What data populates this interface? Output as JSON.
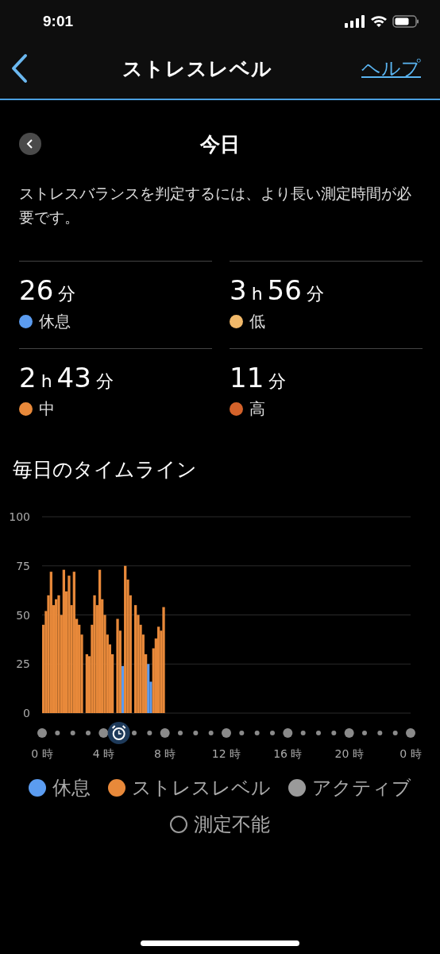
{
  "status_bar": {
    "time": "9:01"
  },
  "nav": {
    "title": "ストレスレベル",
    "help": "ヘルプ"
  },
  "day": {
    "title": "今日"
  },
  "message": "ストレスバランスを判定するには、より長い測定時間が必要です。",
  "stats": [
    {
      "parts": [
        {
          "value": "26",
          "unit": "分"
        }
      ],
      "label": "休息",
      "color": "#5b9cf0"
    },
    {
      "parts": [
        {
          "value": "3",
          "unit": "h"
        },
        {
          "value": "56",
          "unit": "分"
        }
      ],
      "label": "低",
      "color": "#f2b96a"
    },
    {
      "parts": [
        {
          "value": "2",
          "unit": "h"
        },
        {
          "value": "43",
          "unit": "分"
        }
      ],
      "label": "中",
      "color": "#e8893a"
    },
    {
      "parts": [
        {
          "value": "11",
          "unit": "分"
        }
      ],
      "label": "高",
      "color": "#d4622a"
    }
  ],
  "timeline": {
    "title": "毎日のタイムライン",
    "end_label": "0 時",
    "chart_data": {
      "type": "bar",
      "grid": true,
      "legend": "bottom",
      "x": [
        0,
        0.17,
        0.33,
        0.5,
        0.67,
        0.83,
        1,
        1.17,
        1.33,
        1.5,
        1.67,
        1.83,
        2,
        2.17,
        2.33,
        2.5,
        2.67,
        2.83,
        3,
        3.17,
        3.33,
        3.5,
        3.67,
        3.83,
        4,
        4.17,
        4.33,
        4.5,
        4.67,
        4.83,
        5,
        5.17,
        5.33,
        5.5,
        5.67,
        5.83,
        6,
        6.17,
        6.33,
        6.5,
        6.67,
        6.83,
        7,
        7.17,
        7.33,
        7.5,
        7.67,
        7.83
      ],
      "series": [
        {
          "name": "休息",
          "color": "#5b9cf0",
          "values": [
            null,
            null,
            null,
            null,
            null,
            null,
            null,
            null,
            null,
            null,
            null,
            null,
            null,
            null,
            null,
            null,
            null,
            null,
            null,
            null,
            null,
            null,
            null,
            null,
            null,
            null,
            null,
            null,
            null,
            null,
            null,
            24,
            null,
            null,
            null,
            null,
            null,
            null,
            null,
            null,
            null,
            25,
            16,
            null,
            null,
            null,
            null,
            null
          ]
        },
        {
          "name": "ストレスレベル",
          "color": "#e8893a",
          "values": [
            45,
            52,
            60,
            72,
            55,
            58,
            60,
            50,
            73,
            62,
            70,
            55,
            72,
            48,
            45,
            40,
            0,
            30,
            29,
            45,
            60,
            55,
            73,
            58,
            50,
            40,
            35,
            30,
            0,
            48,
            42,
            null,
            75,
            68,
            60,
            0,
            55,
            50,
            45,
            40,
            30,
            null,
            null,
            33,
            38,
            44,
            42,
            54
          ]
        }
      ],
      "xlim": [
        0,
        24
      ],
      "ylim": [
        0,
        100
      ],
      "yticks": [
        0,
        25,
        50,
        75,
        100
      ],
      "xticks": [
        {
          "value": 0,
          "label": "0 時"
        },
        {
          "value": 4,
          "label": "4 時"
        },
        {
          "value": 8,
          "label": "8 時"
        },
        {
          "value": 12,
          "label": "12 時"
        },
        {
          "value": 16,
          "label": "16 時"
        },
        {
          "value": 20,
          "label": "20 時"
        }
      ]
    }
  },
  "legend": [
    {
      "label": "アクティブ",
      "kind": "filled",
      "color": "#9a9a9a"
    },
    {
      "label": "測定不能",
      "kind": "outline",
      "color": "#9a9a9a"
    }
  ]
}
